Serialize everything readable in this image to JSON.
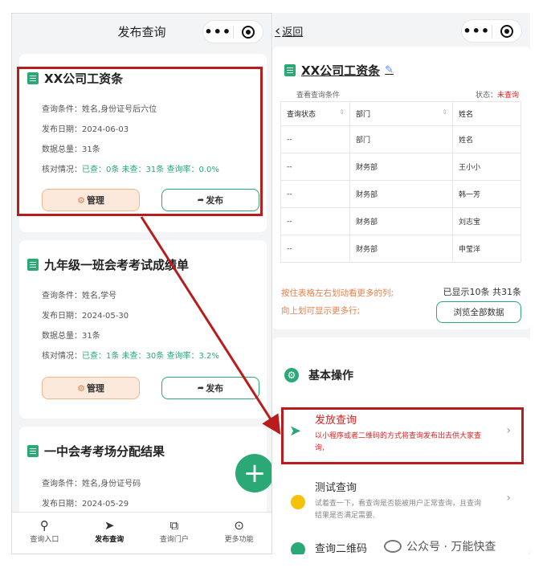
{
  "left": {
    "nav_title": "发布查询",
    "capsule_dots": "•••",
    "cards": [
      {
        "title": "XX公司工资条",
        "cond": "查询条件：姓名,身份证号后六位",
        "date": "发布日期：2024-06-03",
        "total": "数据总量：31条",
        "check_label": "核对情况：",
        "check_value": "已查：0条  未查：31条  查询率：0.0%",
        "manage": "管理",
        "publish": "发布"
      },
      {
        "title": "九年级一班会考考试成绩单",
        "cond": "查询条件：姓名,学号",
        "date": "发布日期：2024-05-30",
        "total": "数据总量：31条",
        "check_label": "核对情况：",
        "check_value": "已查：1条  未查：30条  查询率：3.2%",
        "manage": "管理",
        "publish": "发布"
      },
      {
        "title": "一中会考考场分配结果",
        "cond": "查询条件：姓名,身份证号码",
        "date": "发布日期：2024-05-29"
      }
    ],
    "fab_label": "+",
    "tabs": [
      {
        "label": "查询入口",
        "icon": "search-icon"
      },
      {
        "label": "发布查询",
        "icon": "send-icon"
      },
      {
        "label": "查询门户",
        "icon": "portal-icon"
      },
      {
        "label": "更多功能",
        "icon": "more-icon"
      }
    ]
  },
  "right": {
    "back": "返回",
    "title": "XX公司工资条",
    "view_conditions": "查看查询条件",
    "status_label": "状态：",
    "status_value": "未查询",
    "table_headers": [
      "查询状态",
      "部门",
      "姓名"
    ],
    "table_rows": [
      [
        "--",
        "部门",
        "姓名"
      ],
      [
        "--",
        "财务部",
        "王小小"
      ],
      [
        "--",
        "财务部",
        "韩一芳"
      ],
      [
        "--",
        "财务部",
        "刘志宝"
      ],
      [
        "--",
        "财务部",
        "申莹洋"
      ]
    ],
    "hint1": "按住表格左右划动看更多的列;",
    "hint2": "向上划可显示更多行;",
    "count": "已显示10条 共31条",
    "browse_all": "浏览全部数据",
    "basic_ops": "基本操作",
    "ops": [
      {
        "title": "发放查询",
        "desc": "以小程序或者二维码的方式将查询发布出去供大家查询,"
      },
      {
        "title": "测试查询",
        "desc": "试着查一下，看查询是否能被用户正常查询，且查询结果是否满足需要."
      },
      {
        "title": "查询二维码"
      }
    ]
  },
  "watermark": "公众号 · 万能快查",
  "colors": {
    "accent": "#2aa876",
    "highlight": "#b81c1c",
    "orange": "#e8804c",
    "red": "#e02020"
  }
}
